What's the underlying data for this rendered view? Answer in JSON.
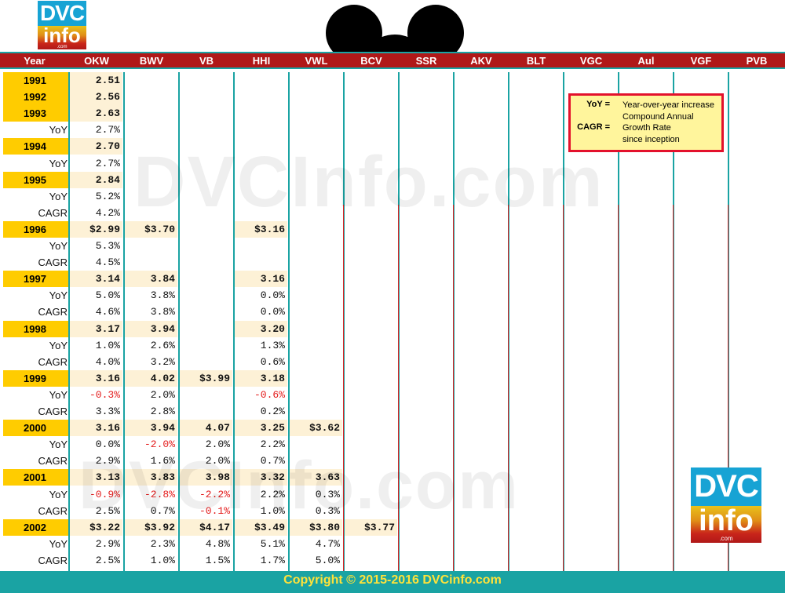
{
  "logo_text": {
    "top": "DVC",
    "bottom": "info",
    "domain": ".com"
  },
  "columns": [
    "Year",
    "OKW",
    "BWV",
    "VB",
    "HHI",
    "VWL",
    "BCV",
    "SSR",
    "AKV",
    "BLT",
    "VGC",
    "Aul",
    "VGF",
    "PVB"
  ],
  "legend": {
    "yoy_term": "YoY =",
    "yoy_def": "Year-over-year increase",
    "cagr_term": "CAGR =",
    "cagr_def_1": "Compound Annual",
    "cagr_def_2": "Growth Rate",
    "cagr_def_3": "since inception"
  },
  "watermark": "DVCInfo.com",
  "copyright": "Copyright © 2015-2016 DVCinfo.com",
  "rows": [
    {
      "type": "year",
      "label": "1991",
      "vals": [
        "2.51",
        "",
        "",
        "",
        "",
        ""
      ]
    },
    {
      "type": "year",
      "label": "1992",
      "vals": [
        "2.56",
        "",
        "",
        "",
        "",
        ""
      ]
    },
    {
      "type": "year",
      "label": "1993",
      "vals": [
        "2.63",
        "",
        "",
        "",
        "",
        ""
      ]
    },
    {
      "type": "sub",
      "label": "YoY",
      "vals": [
        "2.7%",
        "",
        "",
        "",
        "",
        ""
      ]
    },
    {
      "type": "year",
      "label": "1994",
      "vals": [
        "2.70",
        "",
        "",
        "",
        "",
        ""
      ]
    },
    {
      "type": "sub",
      "label": "YoY",
      "vals": [
        "2.7%",
        "",
        "",
        "",
        "",
        ""
      ]
    },
    {
      "type": "year",
      "label": "1995",
      "vals": [
        "2.84",
        "",
        "",
        "",
        "",
        ""
      ]
    },
    {
      "type": "sub",
      "label": "YoY",
      "vals": [
        "5.2%",
        "",
        "",
        "",
        "",
        ""
      ]
    },
    {
      "type": "sub",
      "label": "CAGR",
      "vals": [
        "4.2%",
        "",
        "",
        "",
        "",
        ""
      ]
    },
    {
      "type": "year",
      "label": "1996",
      "vals": [
        "$2.99",
        "$3.70",
        "",
        "$3.16",
        "",
        ""
      ]
    },
    {
      "type": "sub",
      "label": "YoY",
      "vals": [
        "5.3%",
        "",
        "",
        "",
        "",
        ""
      ]
    },
    {
      "type": "sub",
      "label": "CAGR",
      "vals": [
        "4.5%",
        "",
        "",
        "",
        "",
        ""
      ]
    },
    {
      "type": "year",
      "label": "1997",
      "vals": [
        "3.14",
        "3.84",
        "",
        "3.16",
        "",
        ""
      ]
    },
    {
      "type": "sub",
      "label": "YoY",
      "vals": [
        "5.0%",
        "3.8%",
        "",
        "0.0%",
        "",
        ""
      ]
    },
    {
      "type": "sub",
      "label": "CAGR",
      "vals": [
        "4.6%",
        "3.8%",
        "",
        "0.0%",
        "",
        ""
      ]
    },
    {
      "type": "year",
      "label": "1998",
      "vals": [
        "3.17",
        "3.94",
        "",
        "3.20",
        "",
        ""
      ]
    },
    {
      "type": "sub",
      "label": "YoY",
      "vals": [
        "1.0%",
        "2.6%",
        "",
        "1.3%",
        "",
        ""
      ]
    },
    {
      "type": "sub",
      "label": "CAGR",
      "vals": [
        "4.0%",
        "3.2%",
        "",
        "0.6%",
        "",
        ""
      ]
    },
    {
      "type": "year",
      "label": "1999",
      "vals": [
        "3.16",
        "4.02",
        "$3.99",
        "3.18",
        "",
        ""
      ]
    },
    {
      "type": "sub",
      "label": "YoY",
      "vals": [
        "-0.3%",
        "2.0%",
        "",
        "-0.6%",
        "",
        ""
      ]
    },
    {
      "type": "sub",
      "label": "CAGR",
      "vals": [
        "3.3%",
        "2.8%",
        "",
        "0.2%",
        "",
        ""
      ]
    },
    {
      "type": "year",
      "label": "2000",
      "vals": [
        "3.16",
        "3.94",
        "4.07",
        "3.25",
        "$3.62",
        ""
      ]
    },
    {
      "type": "sub",
      "label": "YoY",
      "vals": [
        "0.0%",
        "-2.0%",
        "2.0%",
        "2.2%",
        "",
        ""
      ]
    },
    {
      "type": "sub",
      "label": "CAGR",
      "vals": [
        "2.9%",
        "1.6%",
        "2.0%",
        "0.7%",
        "",
        ""
      ]
    },
    {
      "type": "year",
      "label": "2001",
      "vals": [
        "3.13",
        "3.83",
        "3.98",
        "3.32",
        "3.63",
        ""
      ]
    },
    {
      "type": "sub",
      "label": "YoY",
      "vals": [
        "-0.9%",
        "-2.8%",
        "-2.2%",
        "2.2%",
        "0.3%",
        ""
      ]
    },
    {
      "type": "sub",
      "label": "CAGR",
      "vals": [
        "2.5%",
        "0.7%",
        "-0.1%",
        "1.0%",
        "0.3%",
        ""
      ]
    },
    {
      "type": "year",
      "label": "2002",
      "vals": [
        "$3.22",
        "$3.92",
        "$4.17",
        "$3.49",
        "$3.80",
        "$3.77"
      ]
    },
    {
      "type": "sub",
      "label": "YoY",
      "vals": [
        "2.9%",
        "2.3%",
        "4.8%",
        "5.1%",
        "4.7%",
        ""
      ]
    },
    {
      "type": "sub",
      "label": "CAGR",
      "vals": [
        "2.5%",
        "1.0%",
        "1.5%",
        "1.7%",
        "5.0%",
        ""
      ]
    }
  ],
  "colors": {
    "teal": "#1aa3a3",
    "header_red": "#b01818",
    "year_gold": "#ffcc00",
    "negative": "#e31b1b",
    "legend_bg": "#fff59c"
  }
}
